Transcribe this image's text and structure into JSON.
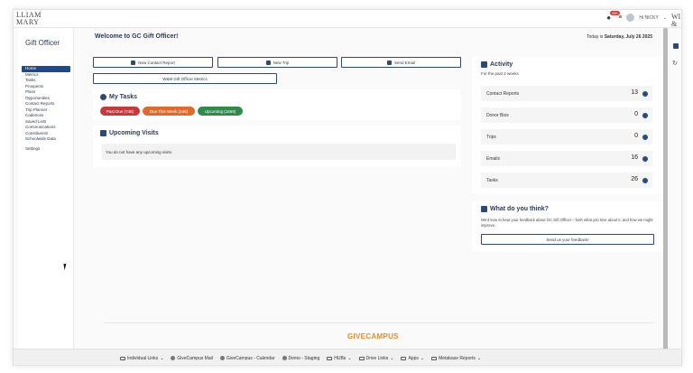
{
  "brand": {
    "logo_text": "LLIAM\nMARY",
    "right_logo_text": "WI\n&"
  },
  "topbar": {
    "notification_count": "99+",
    "user_label": "Hi NICKY"
  },
  "sidebar": {
    "title": "Gift Officer",
    "items": [
      {
        "label": "Home",
        "active": true
      },
      {
        "label": "Metrics"
      },
      {
        "label": "Tasks"
      },
      {
        "label": "Prospects"
      },
      {
        "label": "Plans"
      },
      {
        "label": "Opportunities"
      },
      {
        "label": "Contact Reports"
      },
      {
        "label": "Trip Planner"
      },
      {
        "label": "Cadences"
      },
      {
        "label": "Saved Lists"
      },
      {
        "label": "Communications"
      },
      {
        "label": "Constituents"
      },
      {
        "label": "Schoolwide Data"
      },
      {
        "label": "Settings"
      }
    ]
  },
  "main": {
    "welcome": "Welcome to GC Gift Officer!",
    "today_prefix": "Today is",
    "today_date": "Saturday, July 26 2025",
    "actions": {
      "new_contact_report": "New Contact Report",
      "new_trip": "New Trip",
      "send_email": "Send Email",
      "metrics": "W&M Gift Officer Metrics"
    },
    "tasks": {
      "title": "My Tasks",
      "past_due": "Past Due (748)",
      "due_this_week": "Due This Week (246)",
      "upcoming": "Upcoming (1669)"
    },
    "visits": {
      "title": "Upcoming Visits",
      "empty": "You do not have any upcoming visits."
    },
    "activity": {
      "title": "Activity",
      "subtitle": "For the past 2 weeks",
      "rows": [
        {
          "label": "Contact Reports",
          "count": "13"
        },
        {
          "label": "Donor Bios",
          "count": "0"
        },
        {
          "label": "Trips",
          "count": "0"
        },
        {
          "label": "Emails",
          "count": "16"
        },
        {
          "label": "Tasks",
          "count": "26"
        }
      ]
    },
    "feedback": {
      "title": "What do you think?",
      "text": "We'd love to hear your feedback about GC Gift Officer – both what you love about it, and how we might improve.",
      "button": "Send us your feedback!"
    },
    "footer_brand": "GIVECAMPUS"
  },
  "bookmarks": [
    {
      "label": "Individual Links",
      "type": "folder"
    },
    {
      "label": "GiveCampus Mail",
      "type": "site"
    },
    {
      "label": "GiveCampus - Calendar",
      "type": "site"
    },
    {
      "label": "Demo - Staging",
      "type": "site"
    },
    {
      "label": "HUBs",
      "type": "folder"
    },
    {
      "label": "Drive Links",
      "type": "folder"
    },
    {
      "label": "Apps",
      "type": "folder"
    },
    {
      "label": "Metabase Reports",
      "type": "folder"
    }
  ],
  "colors": {
    "primary": "#2b4a7a",
    "past_due": "#c9383a",
    "due_this_week": "#e06a2a",
    "upcoming": "#2e8b4a",
    "brand_orange": "#e98a2e"
  }
}
